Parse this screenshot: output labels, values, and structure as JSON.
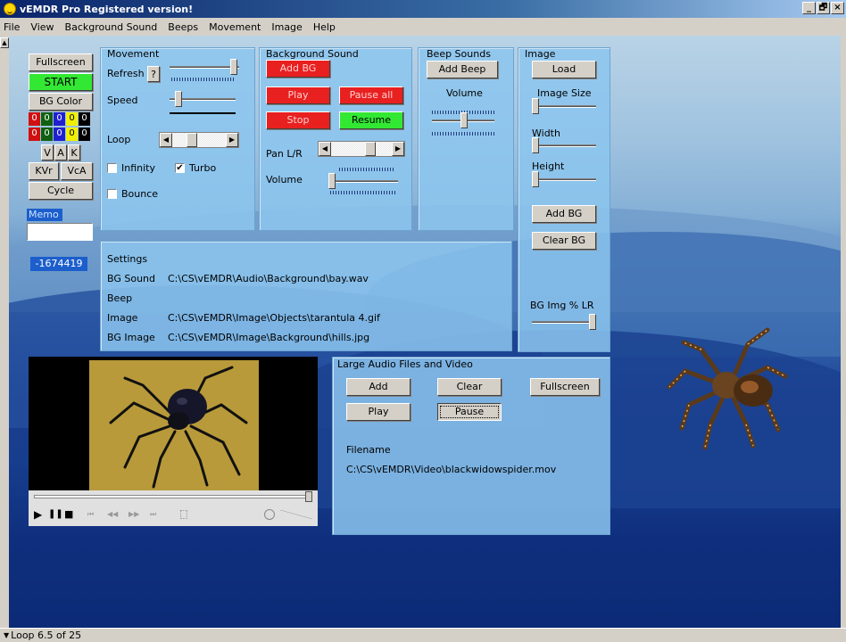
{
  "window": {
    "title": "vEMDR Pro Registered version!",
    "controls": [
      "_",
      "🗗",
      "×"
    ]
  },
  "menu": [
    "File",
    "View",
    "Background Sound",
    "Beeps",
    "Movement",
    "Image",
    "Help"
  ],
  "left": {
    "fullscreen": "Fullscreen",
    "start": "START",
    "bg_color": "BG Color",
    "color_row1": [
      "0",
      "0",
      "0",
      "0",
      "0"
    ],
    "color_row2": [
      "0",
      "0",
      "0",
      "0",
      "0"
    ],
    "vak": [
      "V",
      "A",
      "K"
    ],
    "kvr": "KVr",
    "vca": "VcA",
    "cycle": "Cycle",
    "memo_label": "Memo",
    "memo_value": "",
    "counter": "-1674419"
  },
  "movement": {
    "title": "Movement",
    "refresh": "Refresh",
    "help": "?",
    "speed": "Speed",
    "loop": "Loop",
    "infinity": "Infinity",
    "turbo": "Turbo",
    "bounce": "Bounce",
    "infinity_checked": false,
    "turbo_checked": true,
    "bounce_checked": false
  },
  "bgsound": {
    "title": "Background Sound",
    "add_bg": "Add BG",
    "play": "Play",
    "pause_all": "Pause all",
    "stop": "Stop",
    "resume": "Resume",
    "pan": "Pan L/R",
    "volume": "Volume"
  },
  "beep": {
    "title": "Beep Sounds",
    "add_beep": "Add Beep",
    "volume": "Volume"
  },
  "image": {
    "title": "Image",
    "load": "Load",
    "size": "Image Size",
    "width": "Width",
    "height": "Height",
    "add_bg": "Add BG",
    "clear_bg": "Clear BG",
    "bg_img_lr": "BG Img % LR"
  },
  "settings": {
    "title": "Settings",
    "rows": [
      {
        "label": "BG Sound",
        "value": "C:\\CS\\vEMDR\\Audio\\Background\\bay.wav"
      },
      {
        "label": "Beep",
        "value": ""
      },
      {
        "label": "Image",
        "value": "C:\\CS\\vEMDR\\Image\\Objects\\tarantula 4.gif"
      },
      {
        "label": "BG Image",
        "value": "C:\\CS\\vEMDR\\Image\\Background\\hills.jpg"
      }
    ]
  },
  "large": {
    "title": "Large Audio Files and Video",
    "add": "Add",
    "clear": "Clear",
    "fullscreen": "Fullscreen",
    "play": "Play",
    "pause": "Pause",
    "filename_label": "Filename",
    "filename": "C:\\CS\\vEMDR\\Video\\blackwidowspider.mov"
  },
  "player": {
    "controls": [
      "▶",
      "❚❚",
      "■",
      "⏮",
      "◀◀",
      "▶▶",
      "⏭"
    ]
  },
  "status": "Loop 6.5 of 25"
}
